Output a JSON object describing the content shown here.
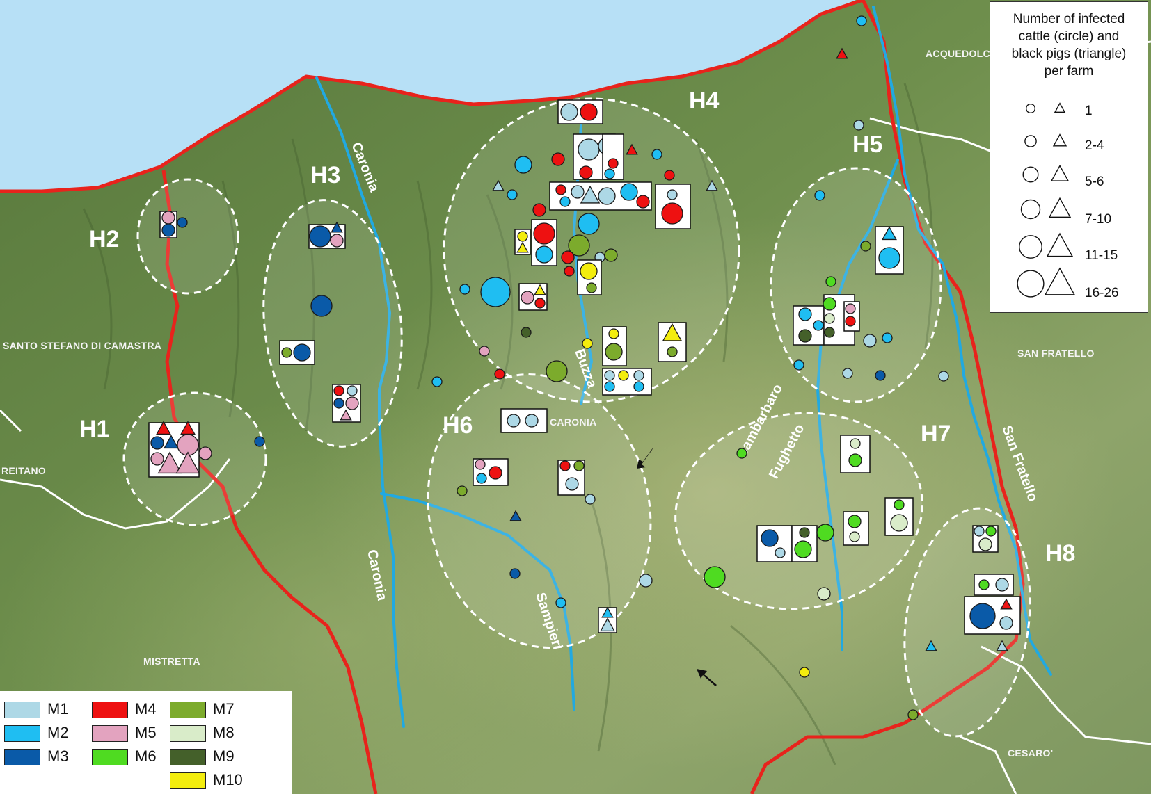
{
  "colors": {
    "M1": "#add8e6",
    "M2": "#1fbef2",
    "M3": "#0a5aa8",
    "M4": "#ee1111",
    "M5": "#e3a3bf",
    "M6": "#4fdb21",
    "M7": "#7cab2c",
    "M8": "#d9ecc9",
    "M9": "#44602a",
    "M10": "#f3ed0e",
    "sea": "#b7e0f6",
    "terrain": "#6b8b49",
    "border": "#e8231c",
    "river": "#21a9e1",
    "road": "#ffffff"
  },
  "size_legend": {
    "title_lines": [
      "Number of infected",
      "cattle (circle) and",
      "black pigs (triangle)",
      "per farm"
    ],
    "classes": [
      "1",
      "2-4",
      "5-6",
      "7-10",
      "11-15",
      "16-26"
    ]
  },
  "model_legend": [
    {
      "key": "M1",
      "label": "M1"
    },
    {
      "key": "M2",
      "label": "M2"
    },
    {
      "key": "M3",
      "label": "M3"
    },
    {
      "key": "M4",
      "label": "M4"
    },
    {
      "key": "M5",
      "label": "M5"
    },
    {
      "key": "M6",
      "label": "M6"
    },
    {
      "key": "M7",
      "label": "M7"
    },
    {
      "key": "M8",
      "label": "M8"
    },
    {
      "key": "M9",
      "label": "M9"
    },
    {
      "key": "M10",
      "label": "M10"
    }
  ],
  "herd_zones": [
    "H1",
    "H2",
    "H3",
    "H4",
    "H5",
    "H6",
    "H7",
    "H8"
  ],
  "place_names": [
    "SANTO STEFANO DI CAMASTRA",
    "REITANO",
    "MISTRETTA",
    "CARONIA",
    "ACQUEDOLCI",
    "SAN FRATELLO",
    "CESARO'"
  ],
  "river_names": [
    "Caronia",
    "Caronia",
    "Buzza",
    "Sambarbaro",
    "Fughetto",
    "Sampieri",
    "San Fratello"
  ]
}
